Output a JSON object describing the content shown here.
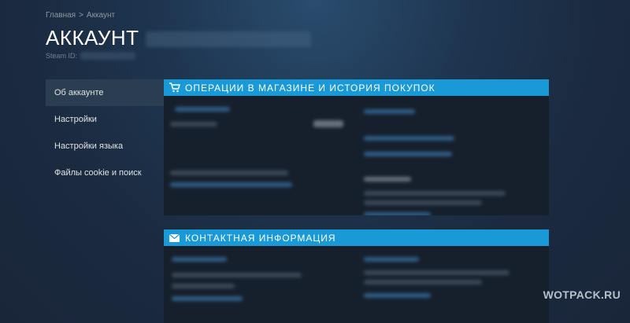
{
  "breadcrumb": {
    "home": "Главная",
    "separator": ">",
    "current": "Аккаунт"
  },
  "header": {
    "title": "АККАУНТ",
    "steam_id_label": "Steam ID:"
  },
  "sidebar": {
    "items": [
      {
        "label": "Об аккаунте",
        "active": true
      },
      {
        "label": "Настройки",
        "active": false
      },
      {
        "label": "Настройки языка",
        "active": false
      },
      {
        "label": "Файлы cookie и поиск",
        "active": false
      }
    ]
  },
  "sections": {
    "store": {
      "title": "ОПЕРАЦИИ В МАГАЗИНЕ И ИСТОРИЯ ПОКУПОК",
      "icon": "cart-icon"
    },
    "contact": {
      "title": "КОНТАКТНАЯ ИНФОРМАЦИЯ",
      "icon": "envelope-icon"
    }
  },
  "colors": {
    "accent": "#1999d6",
    "background": "#1b2838",
    "panel": "#16202d",
    "sidebar_active": "#2b3d50"
  },
  "watermark": "WOTPACK.RU"
}
